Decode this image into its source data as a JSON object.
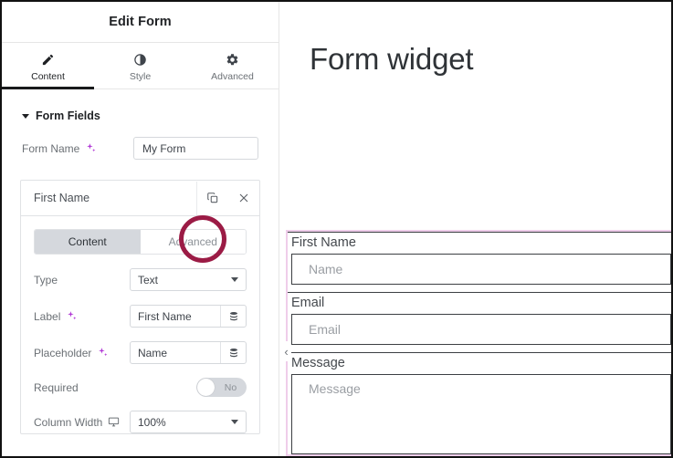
{
  "panel": {
    "title": "Edit Form",
    "tabs": [
      {
        "label": "Content",
        "icon": "pencil-icon",
        "active": true
      },
      {
        "label": "Style",
        "icon": "contrast-icon",
        "active": false
      },
      {
        "label": "Advanced",
        "icon": "gear-icon",
        "active": false
      }
    ],
    "section": {
      "label": "Form Fields",
      "expanded": true
    },
    "form_name": {
      "label": "Form Name",
      "ai_icon": "sparkle-icon",
      "value": "My Form"
    },
    "field_card": {
      "title": "First Name",
      "duplicate_icon": "copy-icon",
      "close_icon": "close-icon",
      "segments": [
        {
          "label": "Content",
          "active": true
        },
        {
          "label": "Advanced",
          "active": false
        }
      ],
      "rows": {
        "type": {
          "label": "Type",
          "value": "Text",
          "control": "select"
        },
        "label": {
          "label": "Label",
          "ai_icon": "sparkle-icon",
          "value": "First Name",
          "button_icon": "layers-icon"
        },
        "placeholder": {
          "label": "Placeholder",
          "ai_icon": "sparkle-icon",
          "value": "Name",
          "button_icon": "layers-icon"
        },
        "required": {
          "label": "Required",
          "value": "No",
          "state": "off"
        },
        "column_width": {
          "label": "Column Width",
          "device_icon": "desktop-icon",
          "value": "100%",
          "control": "select"
        }
      }
    }
  },
  "preview": {
    "heading": "Form widget",
    "collapse_icon": "chevron-left-icon",
    "fields": [
      {
        "label": "First Name",
        "placeholder": "Name",
        "type": "text"
      },
      {
        "label": "Email",
        "placeholder": "Email",
        "type": "text"
      },
      {
        "label": "Message",
        "placeholder": "Message",
        "type": "textarea"
      }
    ]
  },
  "annotation": {
    "shape": "circle",
    "target": "copy-icon",
    "color": "#9b1b45"
  },
  "colors": {
    "accent_black": "#18191b",
    "annotation": "#9b1b45",
    "ai_sparkle": "#b23bd6",
    "selection_outline": "#efcdea",
    "toggle_off_bg": "#d5d8dd"
  }
}
